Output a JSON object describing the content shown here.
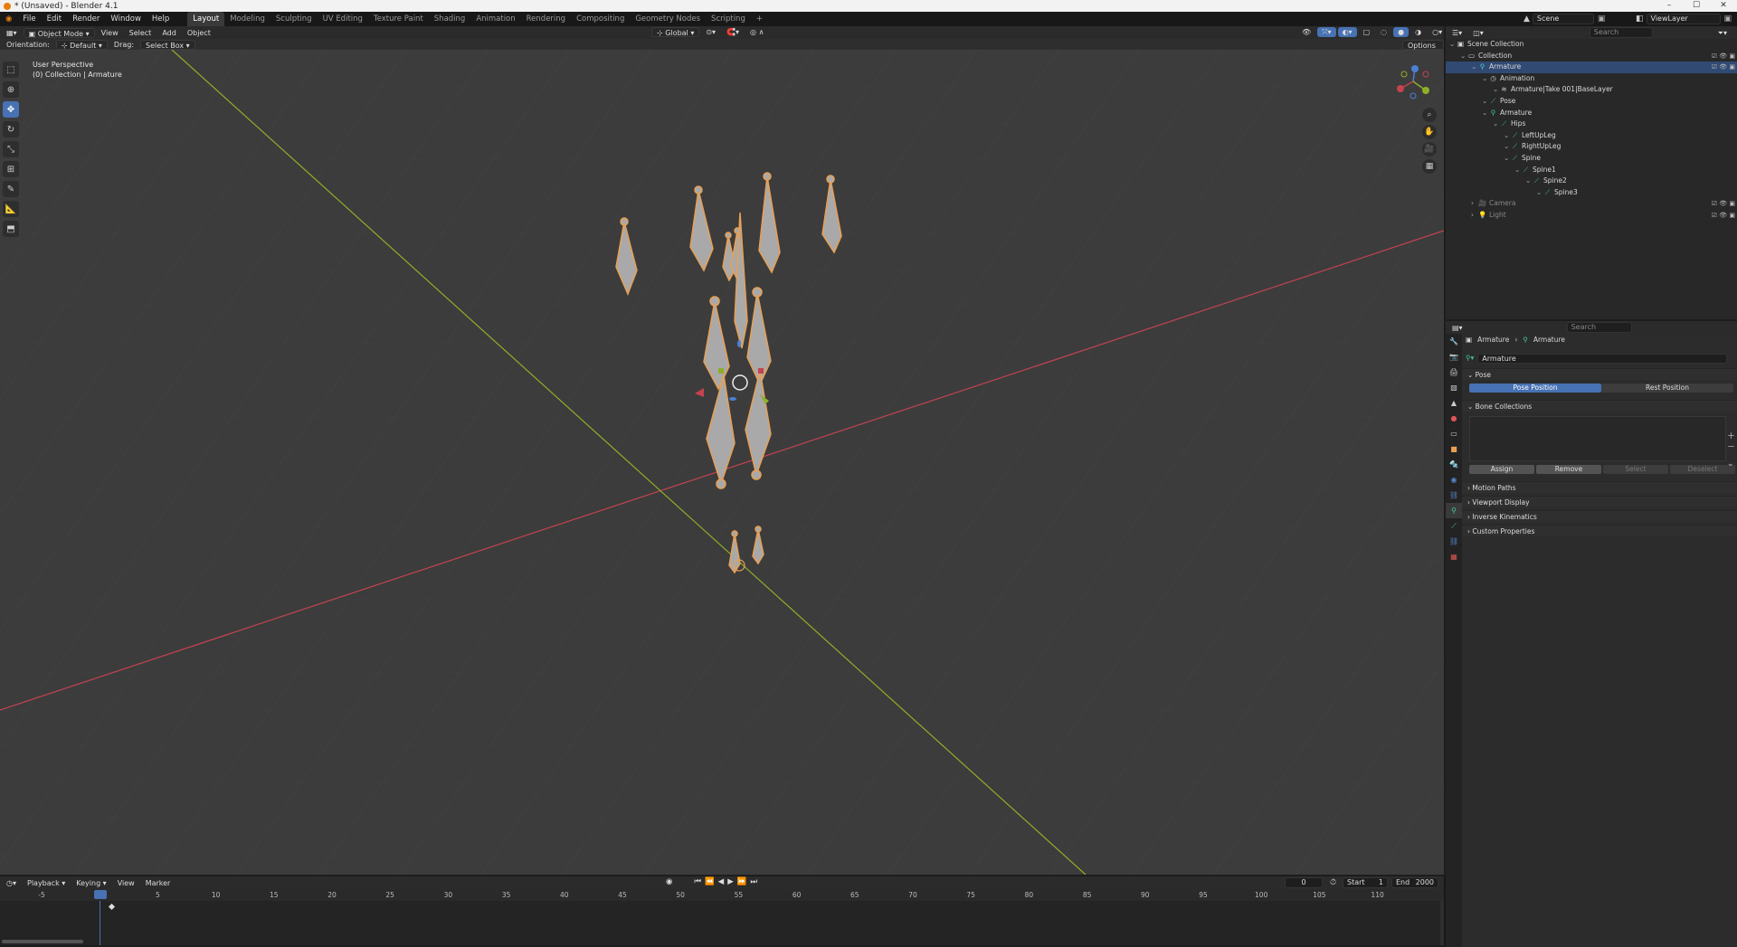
{
  "window": {
    "title": "* (Unsaved) - Blender 4.1"
  },
  "menu": [
    "File",
    "Edit",
    "Render",
    "Window",
    "Help"
  ],
  "workspaces": [
    {
      "label": "Layout",
      "active": true
    },
    {
      "label": "Modeling"
    },
    {
      "label": "Sculpting"
    },
    {
      "label": "UV Editing"
    },
    {
      "label": "Texture Paint"
    },
    {
      "label": "Shading"
    },
    {
      "label": "Animation"
    },
    {
      "label": "Rendering"
    },
    {
      "label": "Compositing"
    },
    {
      "label": "Geometry Nodes"
    },
    {
      "label": "Scripting"
    }
  ],
  "add_workspace": "+",
  "scene": {
    "label": "Scene",
    "viewlayer": "ViewLayer"
  },
  "viewport_header": {
    "mode": "Object Mode",
    "menus": [
      "View",
      "Select",
      "Add",
      "Object"
    ],
    "transform_orientation": "Global"
  },
  "tool_settings": {
    "orientation_label": "Orientation:",
    "orientation_value": "Default",
    "drag_label": "Drag:",
    "drag_value": "Select Box",
    "options": "Options"
  },
  "overlay": {
    "perspective": "User Perspective",
    "collection": "(0) Collection | Armature"
  },
  "outliner": {
    "search_placeholder": "Search",
    "rows": [
      {
        "label": "Scene Collection",
        "depth": 0,
        "icon": "scene-collection-icon"
      },
      {
        "label": "Collection",
        "depth": 1,
        "icon": "collection-icon"
      },
      {
        "label": "Armature",
        "depth": 2,
        "icon": "armature-icon",
        "selected": true
      },
      {
        "label": "Animation",
        "depth": 3,
        "icon": "animation-icon"
      },
      {
        "label": "Armature|Take 001|BaseLayer",
        "depth": 4,
        "icon": "action-icon"
      },
      {
        "label": "Pose",
        "depth": 3,
        "icon": "pose-icon"
      },
      {
        "label": "Armature",
        "depth": 3,
        "icon": "armature-data-icon"
      },
      {
        "label": "Hips",
        "depth": 4,
        "icon": "bone-icon"
      },
      {
        "label": "LeftUpLeg",
        "depth": 5,
        "icon": "bone-icon"
      },
      {
        "label": "RightUpLeg",
        "depth": 5,
        "icon": "bone-icon"
      },
      {
        "label": "Spine",
        "depth": 5,
        "icon": "bone-icon"
      },
      {
        "label": "Spine1",
        "depth": 6,
        "icon": "bone-icon"
      },
      {
        "label": "Spine2",
        "depth": 7,
        "icon": "bone-icon"
      },
      {
        "label": "Spine3",
        "depth": 8,
        "icon": "bone-icon"
      },
      {
        "label": "Camera",
        "depth": 2,
        "icon": "camera-icon",
        "dim": true
      },
      {
        "label": "Light",
        "depth": 2,
        "icon": "light-icon",
        "dim": true
      }
    ]
  },
  "properties": {
    "search_placeholder": "Search",
    "breadcrumb": [
      "Armature",
      "Armature"
    ],
    "datablock": "Armature",
    "pose_panel": "Pose",
    "pose_position": "Pose Position",
    "rest_position": "Rest Position",
    "bone_collections": "Bone Collections",
    "assign": "Assign",
    "remove": "Remove",
    "select": "Select",
    "deselect": "Deselect",
    "panels": [
      "Motion Paths",
      "Viewport Display",
      "Inverse Kinematics",
      "Custom Properties"
    ]
  },
  "timeline": {
    "menus": [
      "Playback",
      "Keying",
      "View",
      "Marker"
    ],
    "current_frame": "0",
    "start_label": "Start",
    "start": "1",
    "end_label": "End",
    "end": "2000",
    "ticks": [
      "-5",
      "0",
      "5",
      "10",
      "15",
      "20",
      "25",
      "30",
      "35",
      "40",
      "45",
      "50",
      "55",
      "60",
      "65",
      "70",
      "75",
      "80",
      "85",
      "90",
      "95",
      "100",
      "105",
      "110"
    ]
  },
  "colors": {
    "accent": "#4772b3",
    "bone_outline": "#e8a055",
    "x_axis": "#c4434f",
    "y_axis": "#8fae28"
  }
}
